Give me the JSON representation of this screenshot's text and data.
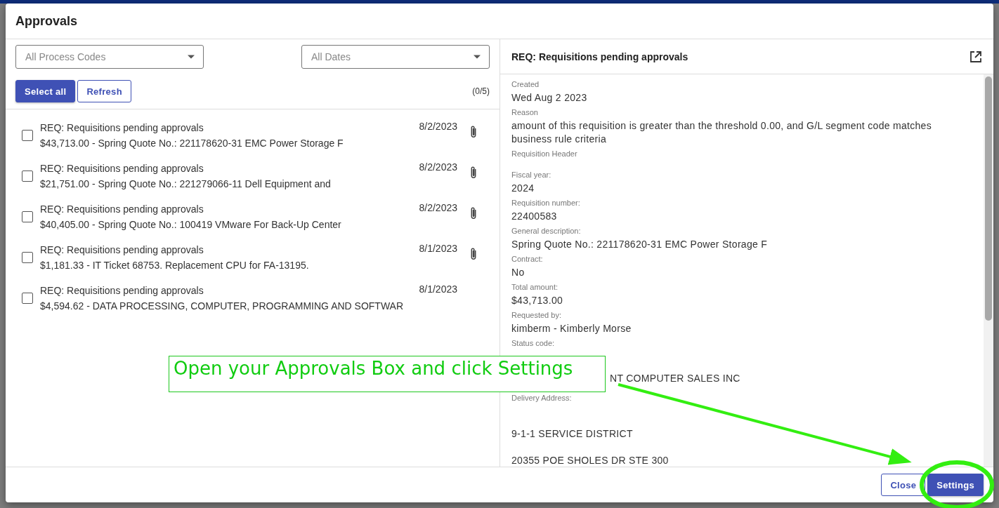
{
  "dialog": {
    "title": "Approvals"
  },
  "filters": [
    {
      "placeholder": "All Process Codes"
    },
    {
      "placeholder": "All Dates"
    }
  ],
  "buttons": [
    {
      "label": "Select all",
      "kind": "primary"
    },
    {
      "label": "Refresh",
      "kind": "outline"
    }
  ],
  "count": "(0/5)",
  "items": [
    {
      "title": "REQ: Requisitions pending approvals",
      "summary": "$43,713.00 - Spring Quote No.: 221178620-31 EMC Power Storage F",
      "date": "8/2/2023",
      "checked": false,
      "attachment": true
    },
    {
      "title": "REQ: Requisitions pending approvals",
      "summary": "$21,751.00 - Spring Quote No.: 221279066-11 Dell Equipment and",
      "date": "8/2/2023",
      "checked": false,
      "attachment": true
    },
    {
      "title": "REQ: Requisitions pending approvals",
      "summary": "$40,405.00 - Spring Quote No.: 100419 VMware For Back-Up Center",
      "date": "8/2/2023",
      "checked": false,
      "attachment": true
    },
    {
      "title": "REQ: Requisitions pending approvals",
      "summary": "$1,181.33 - IT Ticket 68753. Replacement CPU for FA-13195.",
      "date": "8/1/2023",
      "checked": false,
      "attachment": true
    },
    {
      "title": "REQ: Requisitions pending approvals",
      "summary": "$4,594.62 - DATA PROCESSING, COMPUTER, PROGRAMMING AND SOFTWAR",
      "date": "8/1/2023",
      "checked": false,
      "attachment": false
    }
  ],
  "detail": {
    "title": "REQ: Requisitions pending approvals",
    "fields": [
      {
        "label": "Created",
        "value": "Wed Aug 2 2023"
      },
      {
        "label": "Reason",
        "value": "amount of this requisition is greater than the threshold 0.00, and G/L segment code matches business rule criteria"
      },
      {
        "label": "Requisition Header"
      },
      {
        "label": "Fiscal year:",
        "value": "2024"
      },
      {
        "label": "Requisition number:",
        "value": "22400583"
      },
      {
        "label": "General description:",
        "value": "Spring Quote No.: 221178620-31 EMC Power Storage F"
      },
      {
        "label": "Contract:",
        "value": "No"
      },
      {
        "label": "Total amount:",
        "value": "$43,713.00"
      },
      {
        "label": "Requested by:",
        "value": "kimberm - Kimberly Morse"
      },
      {
        "label": "Status code:"
      },
      {
        "kind": "partial",
        "value": "NT COMPUTER SALES INC"
      },
      {
        "label": "Delivery Address:"
      },
      {
        "kind": "address",
        "value": "9-1-1 SERVICE DISTRICT"
      },
      {
        "kind": "address",
        "value": "20355 POE SHOLES DR STE 300"
      }
    ]
  },
  "footer": [
    {
      "label": "Close",
      "kind": "outline"
    },
    {
      "label": "Settings",
      "kind": "primary"
    }
  ],
  "annotation": {
    "text": "Open your Approvals Box and click Settings"
  }
}
